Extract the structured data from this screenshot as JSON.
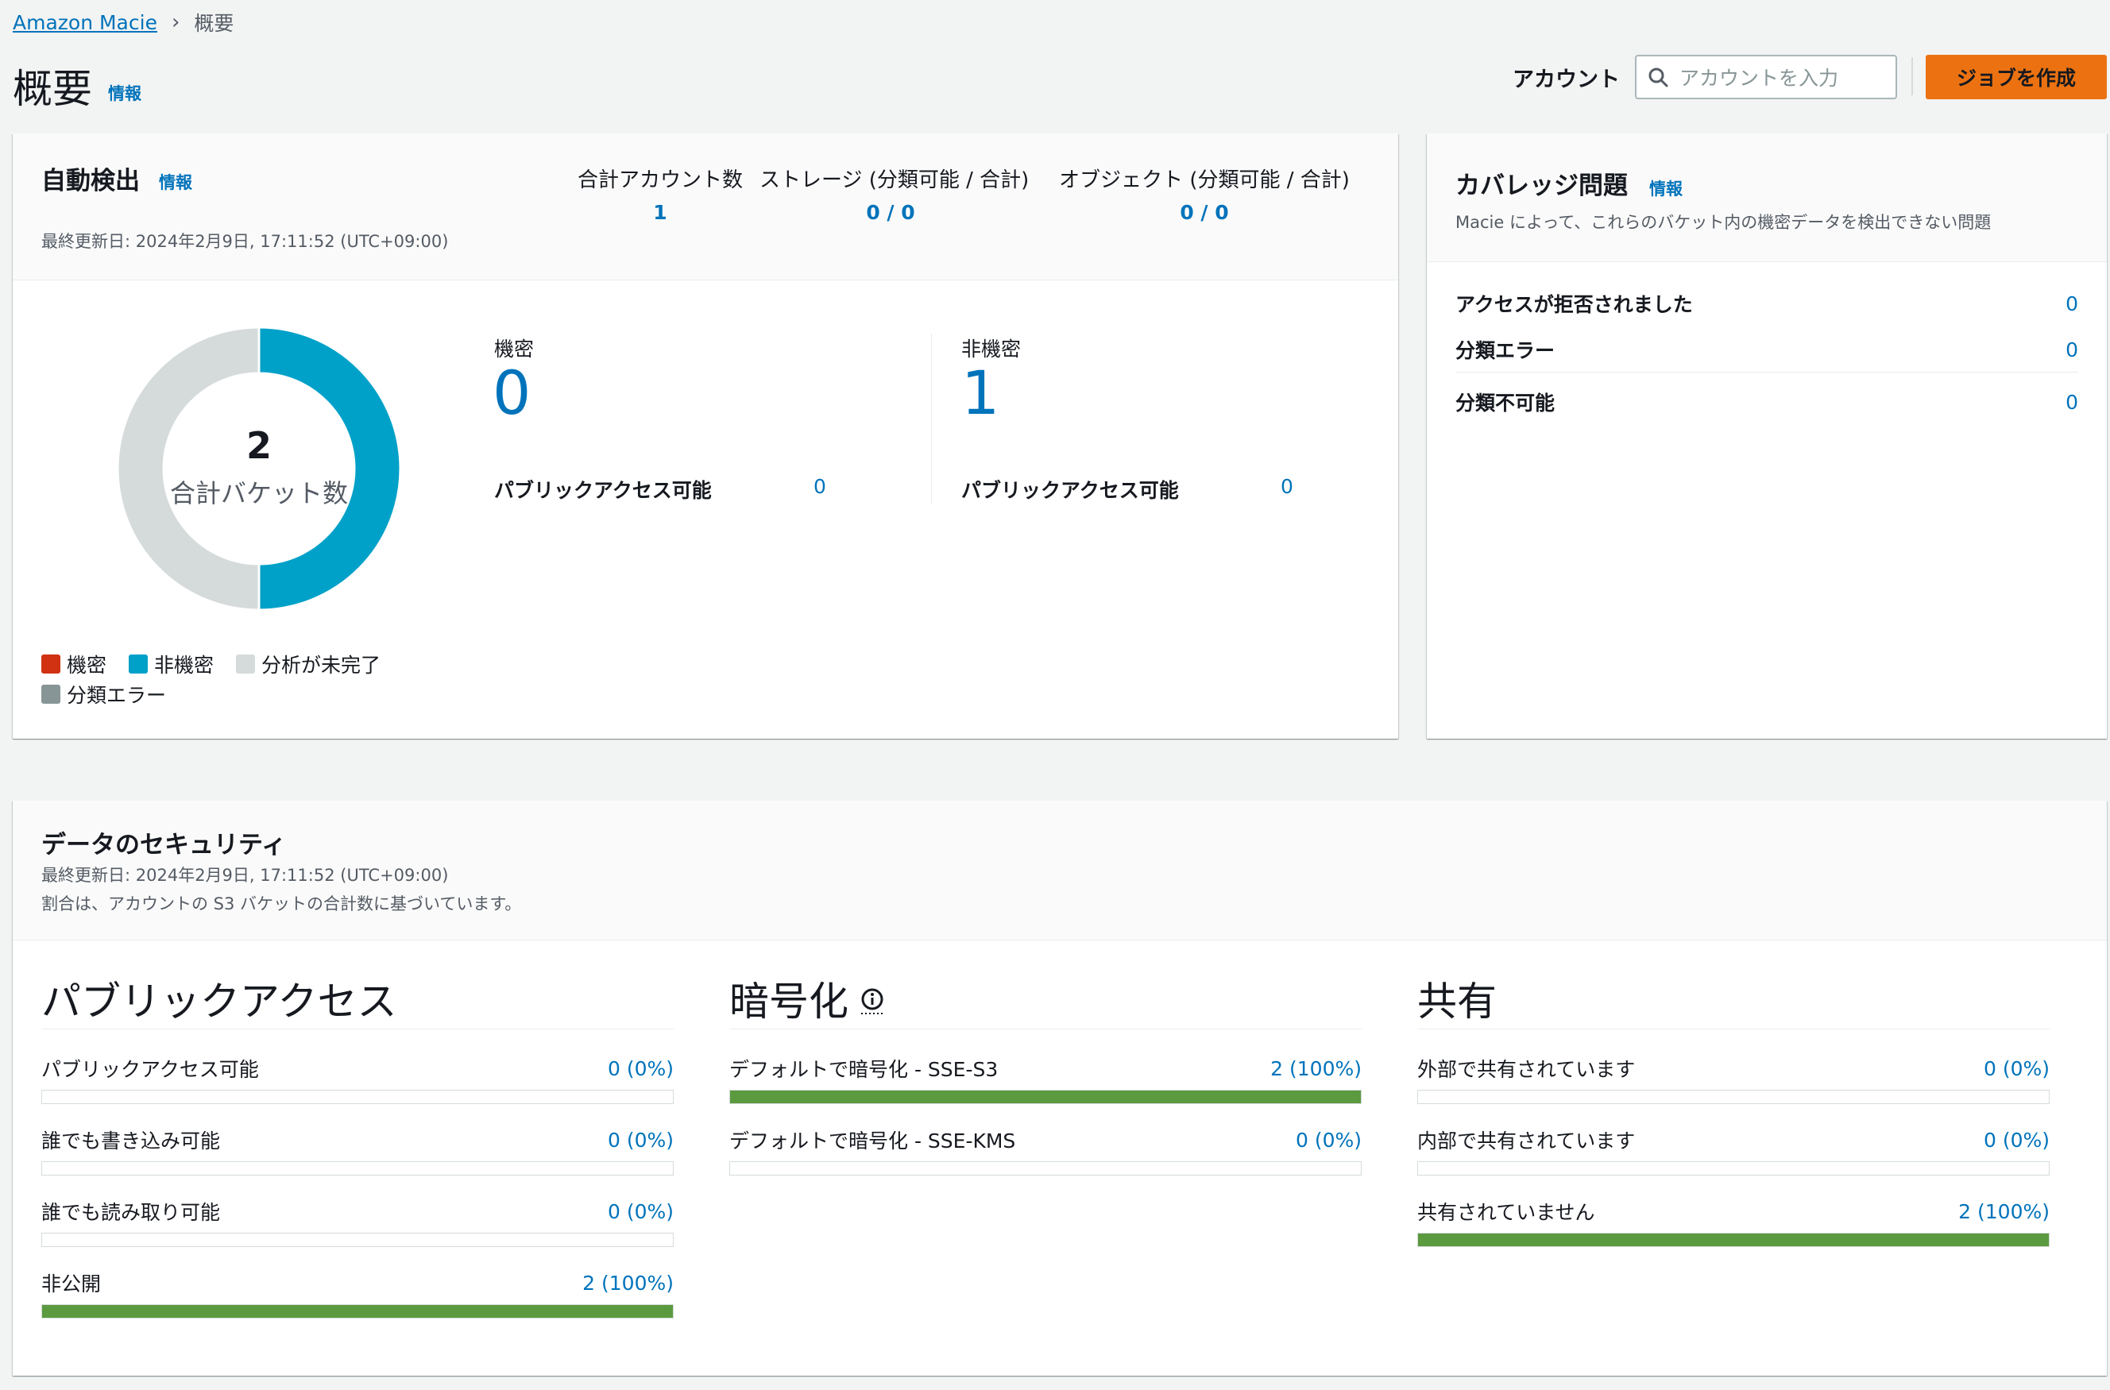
{
  "breadcrumb": {
    "root": "Amazon Macie",
    "separator": "›",
    "current": "概要"
  },
  "header": {
    "title": "概要",
    "info": "情報",
    "account_label": "アカウント",
    "account_placeholder": "アカウントを入力",
    "create_job": "ジョブを作成"
  },
  "auto_discovery": {
    "title": "自動検出",
    "info": "情報",
    "last_updated": "最終更新日: 2024年2月9日, 17:11:52 (UTC+09:00)",
    "stats": [
      {
        "label": "合計アカウント数",
        "value": "1"
      },
      {
        "label": "ストレージ (分類可能 / 合計)",
        "value": "0 / 0"
      },
      {
        "label": "オブジェクト (分類可能 / 合計)",
        "value": "0 / 0"
      }
    ],
    "donut": {
      "total": "2",
      "total_label": "合計バケット数",
      "segments": [
        {
          "name": "非機密",
          "fraction": 0.5,
          "color": "#00a1c9"
        },
        {
          "name": "分析が未完了",
          "fraction": 0.5,
          "color": "#d5dbdb"
        }
      ]
    },
    "legend": [
      {
        "label": "機密",
        "color": "#d13212"
      },
      {
        "label": "非機密",
        "color": "#00a1c9"
      },
      {
        "label": "分析が未完了",
        "color": "#d5dbdb"
      },
      {
        "label": "分類エラー",
        "color": "#879596"
      }
    ],
    "sensitive": {
      "label": "機密",
      "count": "0",
      "public_label": "パブリックアクセス可能",
      "public_value": "0"
    },
    "non_sensitive": {
      "label": "非機密",
      "count": "1",
      "public_label": "パブリックアクセス可能",
      "public_value": "0"
    }
  },
  "coverage": {
    "title": "カバレッジ問題",
    "info": "情報",
    "description": "Macie によって、これらのバケット内の機密データを検出できない問題",
    "rows": [
      {
        "label": "アクセスが拒否されました",
        "value": "0"
      },
      {
        "label": "分類エラー",
        "value": "0"
      },
      {
        "label": "分類不可能",
        "value": "0"
      }
    ]
  },
  "data_security": {
    "title": "データのセキュリティ",
    "last_updated": "最終更新日: 2024年2月9日, 17:11:52 (UTC+09:00)",
    "note": "割合は、アカウントの S3 バケットの合計数に基づいています。",
    "columns": [
      {
        "title": "パブリックアクセス",
        "metrics": [
          {
            "label": "パブリックアクセス可能",
            "value": "0 (0%)",
            "fraction": 0
          },
          {
            "label": "誰でも書き込み可能",
            "value": "0 (0%)",
            "fraction": 0
          },
          {
            "label": "誰でも読み取り可能",
            "value": "0 (0%)",
            "fraction": 0
          },
          {
            "label": "非公開",
            "value": "2 (100%)",
            "fraction": 1
          }
        ]
      },
      {
        "title": "暗号化",
        "metrics": [
          {
            "label": "デフォルトで暗号化 - SSE-S3",
            "value": "2 (100%)",
            "fraction": 1
          },
          {
            "label": "デフォルトで暗号化 - SSE-KMS",
            "value": "0 (0%)",
            "fraction": 0
          }
        ]
      },
      {
        "title": "共有",
        "metrics": [
          {
            "label": "外部で共有されています",
            "value": "0 (0%)",
            "fraction": 0
          },
          {
            "label": "内部で共有されています",
            "value": "0 (0%)",
            "fraction": 0
          },
          {
            "label": "共有されていません",
            "value": "2 (100%)",
            "fraction": 1
          }
        ]
      }
    ]
  }
}
